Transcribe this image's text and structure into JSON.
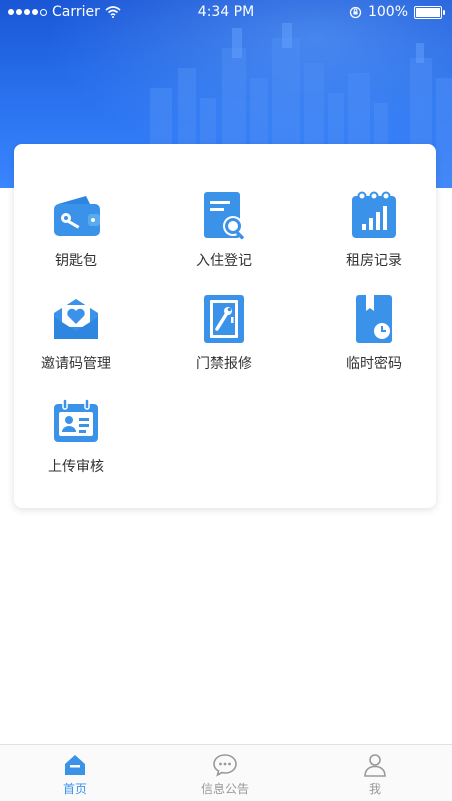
{
  "status_bar": {
    "carrier": "Carrier",
    "time": "4:34 PM",
    "battery": "100%"
  },
  "menu": {
    "items": [
      {
        "label": "钥匙包",
        "icon": "wallet-key-icon"
      },
      {
        "label": "入住登记",
        "icon": "document-search-icon"
      },
      {
        "label": "租房记录",
        "icon": "calendar-chart-icon"
      },
      {
        "label": "邀请码管理",
        "icon": "envelope-heart-icon"
      },
      {
        "label": "门禁报修",
        "icon": "door-wrench-icon"
      },
      {
        "label": "临时密码",
        "icon": "book-clock-icon"
      },
      {
        "label": "上传审核",
        "icon": "id-card-icon"
      }
    ]
  },
  "tabbar": {
    "tabs": [
      {
        "label": "首页",
        "icon": "home-icon",
        "active": true
      },
      {
        "label": "信息公告",
        "icon": "chat-bubble-icon",
        "active": false
      },
      {
        "label": "我",
        "icon": "user-icon",
        "active": false
      }
    ]
  },
  "colors": {
    "accent": "#3a93e8",
    "hero": "#2a73f0",
    "tab_inactive": "#999999"
  }
}
